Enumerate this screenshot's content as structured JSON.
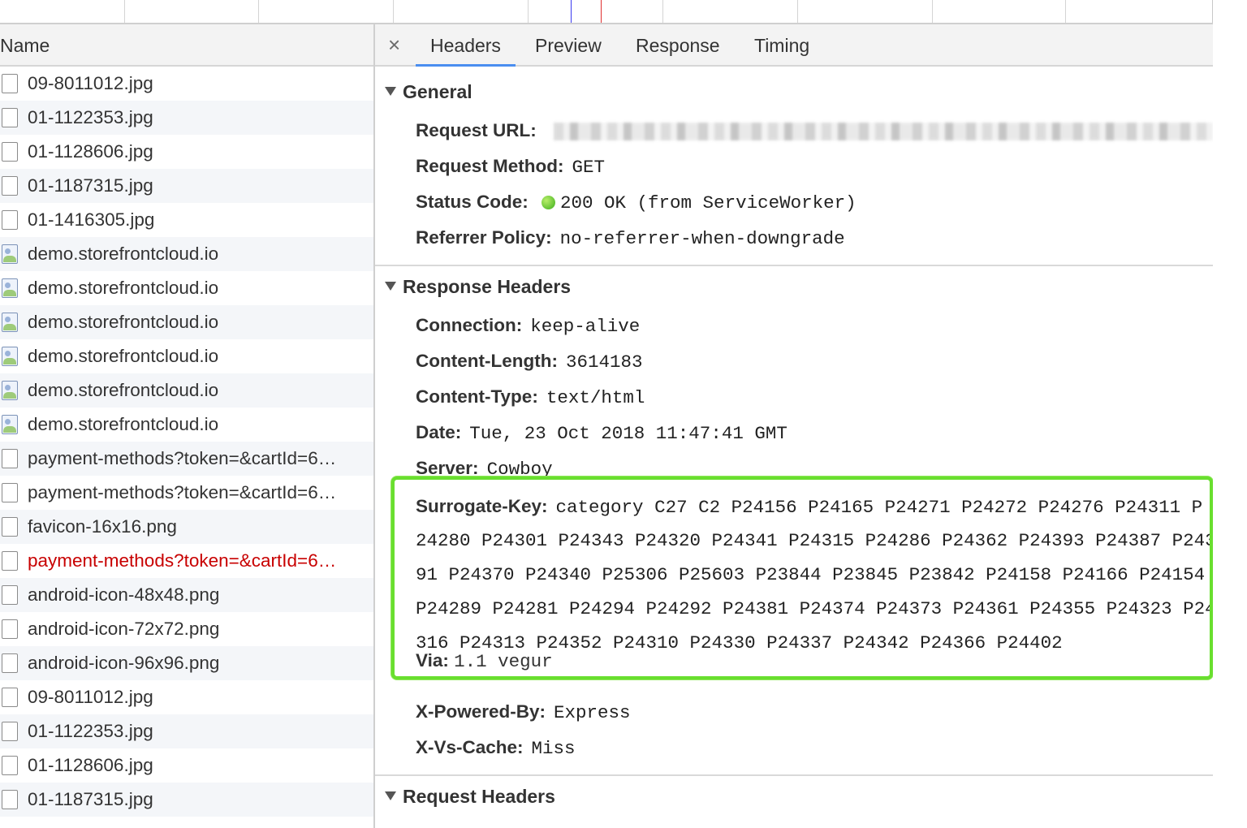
{
  "request_list": {
    "header": "Name",
    "rows": [
      {
        "name": "09-8011012.jpg",
        "icon": "file-icon"
      },
      {
        "name": "01-1122353.jpg",
        "icon": "file-icon"
      },
      {
        "name": "01-1128606.jpg",
        "icon": "file-icon"
      },
      {
        "name": "01-1187315.jpg",
        "icon": "file-icon"
      },
      {
        "name": "01-1416305.jpg",
        "icon": "file-icon"
      },
      {
        "name": "demo.storefrontcloud.io",
        "icon": "image-icon"
      },
      {
        "name": "demo.storefrontcloud.io",
        "icon": "image-icon"
      },
      {
        "name": "demo.storefrontcloud.io",
        "icon": "image-icon"
      },
      {
        "name": "demo.storefrontcloud.io",
        "icon": "image-icon"
      },
      {
        "name": "demo.storefrontcloud.io",
        "icon": "image-icon"
      },
      {
        "name": "demo.storefrontcloud.io",
        "icon": "image-icon"
      },
      {
        "name": "payment-methods?token=&cartId=6…",
        "icon": "file-icon"
      },
      {
        "name": "payment-methods?token=&cartId=6…",
        "icon": "file-icon"
      },
      {
        "name": "favicon-16x16.png",
        "icon": "file-icon"
      },
      {
        "name": "payment-methods?token=&cartId=6…",
        "icon": "file-icon",
        "error": true
      },
      {
        "name": "android-icon-48x48.png",
        "icon": "file-icon"
      },
      {
        "name": "android-icon-72x72.png",
        "icon": "file-icon"
      },
      {
        "name": "android-icon-96x96.png",
        "icon": "file-icon"
      },
      {
        "name": "09-8011012.jpg",
        "icon": "file-icon"
      },
      {
        "name": "01-1122353.jpg",
        "icon": "file-icon"
      },
      {
        "name": "01-1128606.jpg",
        "icon": "file-icon"
      },
      {
        "name": "01-1187315.jpg",
        "icon": "file-icon"
      }
    ]
  },
  "tabs": {
    "close": "×",
    "headers": "Headers",
    "preview": "Preview",
    "response": "Response",
    "timing": "Timing",
    "active": "Headers"
  },
  "general": {
    "title": "General",
    "request_url_label": "Request URL:",
    "request_method_label": "Request Method:",
    "request_method": "GET",
    "status_code_label": "Status Code:",
    "status_code": "200 OK (from ServiceWorker)",
    "referrer_policy_label": "Referrer Policy:",
    "referrer_policy": "no-referrer-when-downgrade"
  },
  "response_headers": {
    "title": "Response Headers",
    "connection_label": "Connection:",
    "connection": "keep-alive",
    "content_length_label": "Content-Length:",
    "content_length": "3614183",
    "content_type_label": "Content-Type:",
    "content_type": "text/html",
    "date_label": "Date:",
    "date": "Tue, 23 Oct 2018 11:47:41 GMT",
    "server_label": "Server:",
    "server": "Cowboy",
    "surrogate_key_label": "Surrogate-Key:",
    "surrogate_key_lines": [
      "category C27 C2 P24156 P24165 P24271 P24272 P24276 P24311 P",
      "24280 P24301 P24343 P24320 P24341 P24315 P24286 P24362 P24393 P24387 P243",
      "91 P24370 P24340 P25306 P25603 P23844 P23845 P23842 P24158 P24166 P24154",
      "P24289 P24281 P24294 P24292 P24381 P24374 P24373 P24361 P24355 P24323 P24",
      "316 P24313 P24352 P24310 P24330 P24337 P24342 P24366 P24402"
    ],
    "via_label": "Via:",
    "via": "1.1 vegur",
    "x_powered_by_label": "X-Powered-By:",
    "x_powered_by": "Express",
    "x_vs_cache_label": "X-Vs-Cache:",
    "x_vs_cache": "Miss"
  },
  "request_headers": {
    "title": "Request Headers"
  },
  "colors": {
    "highlight": "#69df2f",
    "error_text": "#c80000",
    "active_tab": "#4a8ef0",
    "status_ok": "#3bae1b"
  }
}
